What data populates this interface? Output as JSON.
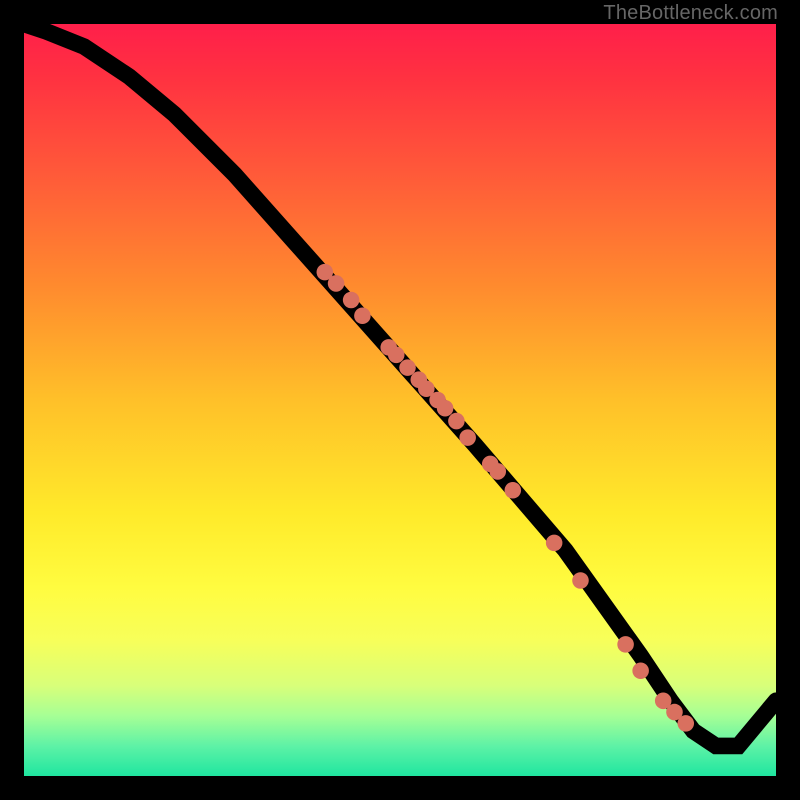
{
  "attribution": "TheBottleneck.com",
  "chart_data": {
    "type": "line",
    "title": "",
    "xlabel": "",
    "ylabel": "",
    "xlim": [
      0,
      100
    ],
    "ylim": [
      0,
      100
    ],
    "series": [
      {
        "name": "curve",
        "x": [
          0,
          3,
          8,
          14,
          20,
          28,
          36,
          44,
          52,
          60,
          66,
          72,
          77,
          82,
          86,
          89,
          92,
          95,
          100
        ],
        "y": [
          100,
          99,
          97,
          93,
          88,
          80,
          71,
          62,
          53,
          44,
          37,
          30,
          23,
          16,
          10,
          6,
          4,
          4,
          10
        ]
      }
    ],
    "markers": {
      "name": "points",
      "x": [
        40,
        41.5,
        43.5,
        45,
        48.5,
        49.5,
        51,
        52.5,
        53.5,
        55,
        56,
        57.5,
        59,
        62,
        63,
        65,
        70.5,
        74,
        80,
        82,
        85,
        86.5,
        88
      ],
      "y": [
        67,
        65.5,
        63.3,
        61.2,
        57,
        56,
        54.3,
        52.7,
        51.5,
        50,
        48.9,
        47.2,
        45,
        41.5,
        40.5,
        38,
        31,
        26,
        17.5,
        14,
        10,
        8.5,
        7
      ]
    }
  }
}
